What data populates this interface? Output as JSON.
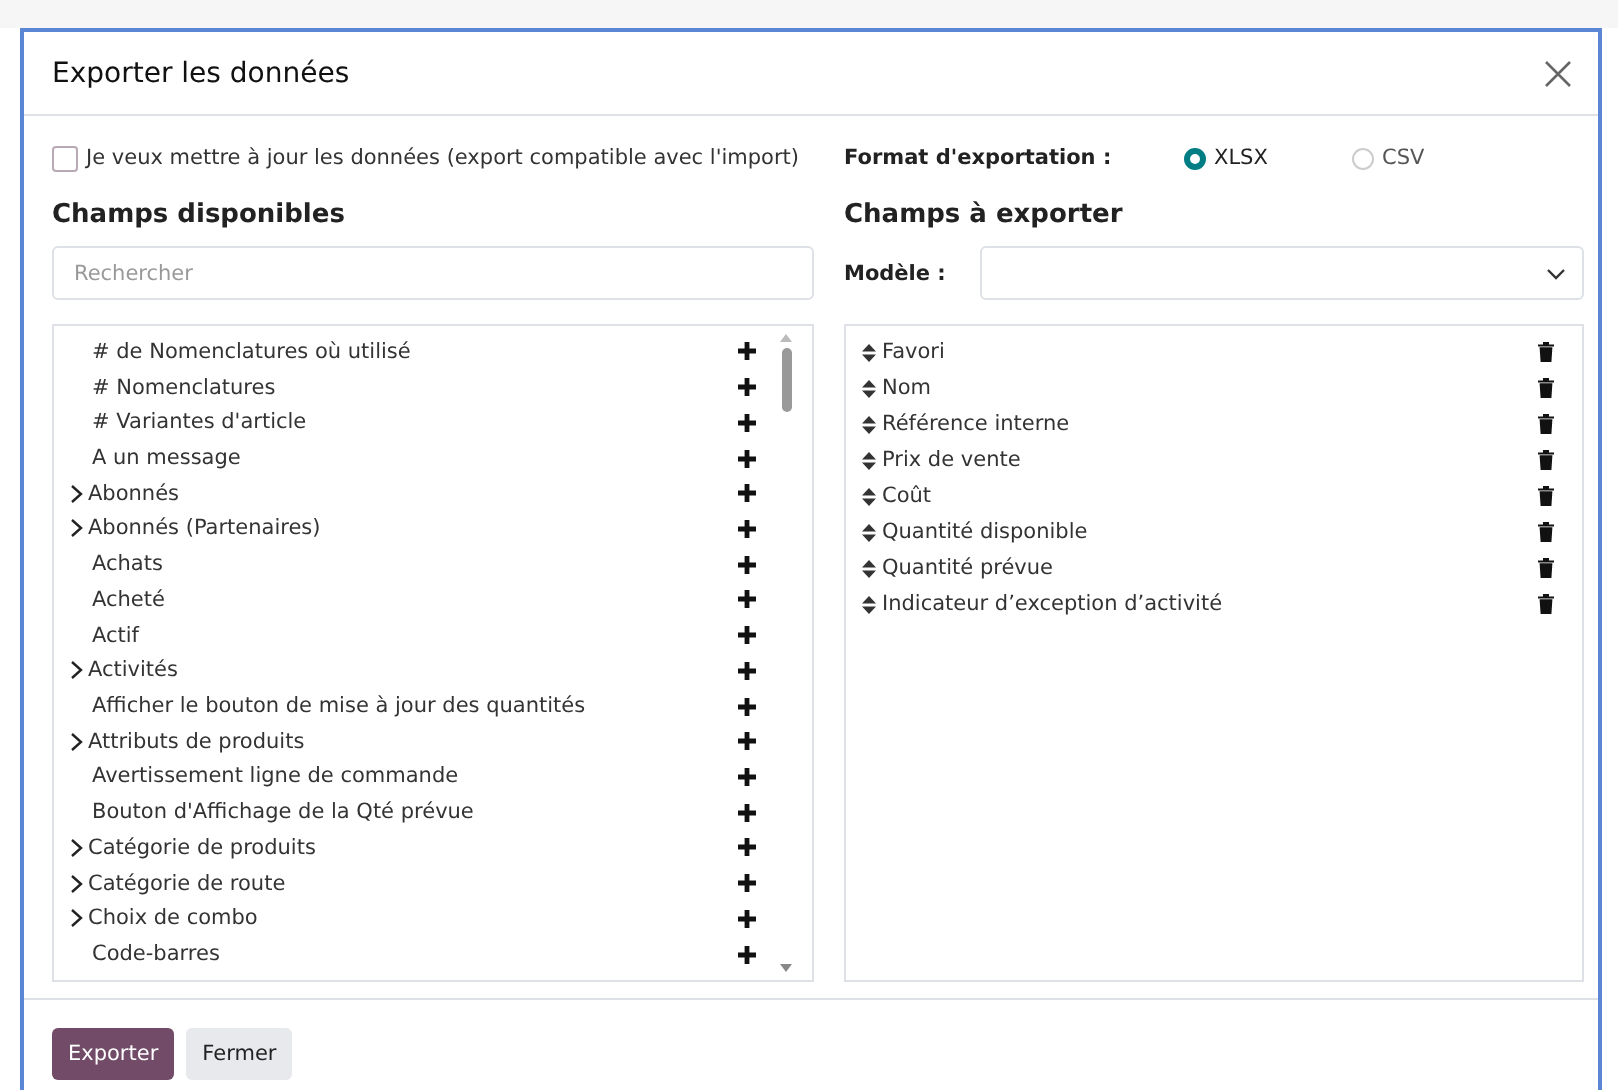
{
  "dialog": {
    "title": "Exporter les données"
  },
  "import_compat": {
    "label": "Je veux mettre à jour les données (export compatible avec l'import)",
    "checked": false
  },
  "format": {
    "label": "Format d'exportation :",
    "options": [
      {
        "label": "XLSX",
        "selected": true
      },
      {
        "label": "CSV",
        "selected": false
      }
    ]
  },
  "available": {
    "heading": "Champs disponibles",
    "search": {
      "placeholder": "Rechercher"
    },
    "items": [
      {
        "label": "# de Nomenclatures où utilisé",
        "expandable": false
      },
      {
        "label": "# Nomenclatures",
        "expandable": false
      },
      {
        "label": "# Variantes d'article",
        "expandable": false
      },
      {
        "label": "A un message",
        "expandable": false
      },
      {
        "label": "Abonnés",
        "expandable": true
      },
      {
        "label": "Abonnés (Partenaires)",
        "expandable": true
      },
      {
        "label": "Achats",
        "expandable": false
      },
      {
        "label": "Acheté",
        "expandable": false
      },
      {
        "label": "Actif",
        "expandable": false
      },
      {
        "label": "Activités",
        "expandable": true
      },
      {
        "label": "Afficher le bouton de mise à jour des quantités",
        "expandable": false
      },
      {
        "label": "Attributs de produits",
        "expandable": true
      },
      {
        "label": "Avertissement ligne de commande",
        "expandable": false
      },
      {
        "label": "Bouton d'Affichage de la Qté prévue",
        "expandable": false
      },
      {
        "label": "Catégorie de produits",
        "expandable": true
      },
      {
        "label": "Catégorie de route",
        "expandable": true
      },
      {
        "label": "Choix de combo",
        "expandable": true
      },
      {
        "label": "Code-barres",
        "expandable": false
      }
    ]
  },
  "export": {
    "heading": "Champs à exporter",
    "model_label": "Modèle :",
    "fields": [
      "Favori",
      "Nom",
      "Référence interne",
      "Prix de vente",
      "Coût",
      "Quantité disponible",
      "Quantité prévue",
      "Indicateur d’exception d’activité"
    ]
  },
  "buttons": [
    {
      "label": "Exporter",
      "kind": "primary"
    },
    {
      "label": "Fermer",
      "kind": "secondary"
    }
  ]
}
